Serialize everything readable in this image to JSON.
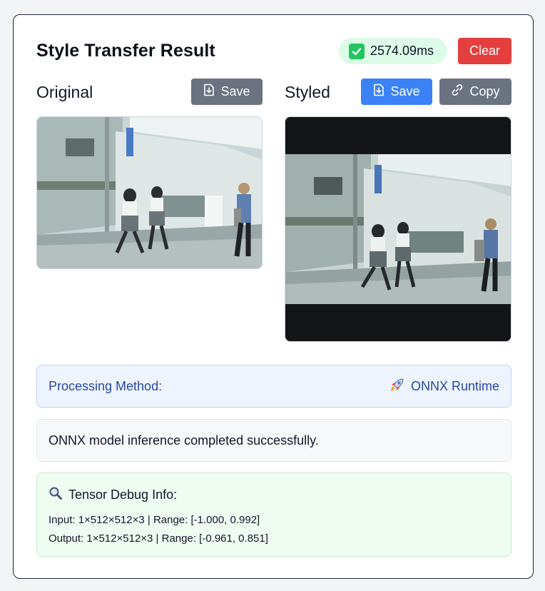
{
  "header": {
    "title": "Style Transfer Result",
    "time_text": "2574.09ms",
    "clear_label": "Clear"
  },
  "original": {
    "label": "Original",
    "save_label": "Save",
    "image_description": "street scene with students walking"
  },
  "styled": {
    "label": "Styled",
    "save_label": "Save",
    "copy_label": "Copy",
    "image_description": "stylized street scene with students walking"
  },
  "processing": {
    "label": "Processing Method:",
    "value": "ONNX Runtime",
    "icon": "rocket-icon"
  },
  "message": "ONNX model inference completed successfully.",
  "debug": {
    "title": "Tensor Debug Info:",
    "icon": "magnifier-icon",
    "input_line": "Input: 1×512×512×3 | Range: [-1.000, 0.992]",
    "output_line": "Output: 1×512×512×3 | Range: [-0.961, 0.851]"
  },
  "colors": {
    "clear": "#e53e3e",
    "save_gray": "#6b7280",
    "save_blue": "#3b82f6",
    "method_text": "#2547a8",
    "badge_bg": "#dcfce7"
  }
}
